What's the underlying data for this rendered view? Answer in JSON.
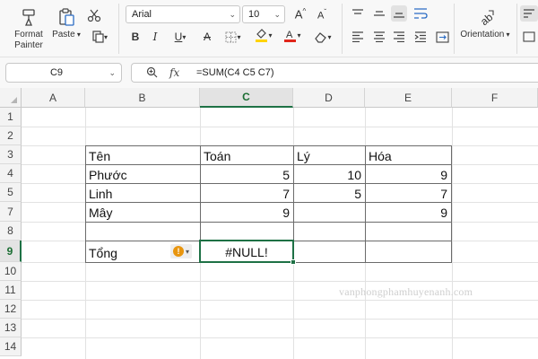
{
  "ribbon": {
    "format_painter_label": "Format Painter",
    "paste_label": "Paste",
    "font_name": "Arial",
    "font_size": "10",
    "orientation_label": "Orientation",
    "icons": [
      "format-painter-icon",
      "paste-icon",
      "cut-icon",
      "copy-icon",
      "bold-icon",
      "italic-icon",
      "underline-icon",
      "strikethrough-icon",
      "borders-icon",
      "fill-color-icon",
      "font-color-icon",
      "clear-icon",
      "increase-font-icon",
      "decrease-font-icon",
      "align-top-icon",
      "align-middle-icon",
      "align-bottom-icon",
      "wrap-icon",
      "align-left-icon",
      "align-center-icon",
      "align-right-icon",
      "indent-icon",
      "merge-icon",
      "orientation-icon"
    ],
    "fill_color": "#ffd400",
    "font_color": "#e0261b"
  },
  "formula_bar": {
    "name_box": "C9",
    "formula": "=SUM(C4 C5 C7)"
  },
  "sheet": {
    "columns": [
      "A",
      "B",
      "C",
      "D",
      "E",
      "F"
    ],
    "rows": [
      "1",
      "2",
      "3",
      "4",
      "5",
      "7",
      "8",
      "9",
      "10",
      "11",
      "12",
      "13",
      "14"
    ],
    "selected_cell": "C9",
    "cells": {
      "B3": "Tên",
      "C3": "Toán",
      "D3": "Lý",
      "E3": "Hóa",
      "B4": "Phước",
      "C4": "5",
      "D4": "10",
      "E4": "9",
      "B5": "Linh",
      "C5": "7",
      "D5": "5",
      "E5": "7",
      "B7": "Mây",
      "C7": "9",
      "E7": "9",
      "B9": "Tổng",
      "C9": "#NULL!"
    },
    "accent_color": "#1e7145",
    "error_badge_color": "#e8950e"
  },
  "watermark": "vanphongphamhuyenanh.com"
}
